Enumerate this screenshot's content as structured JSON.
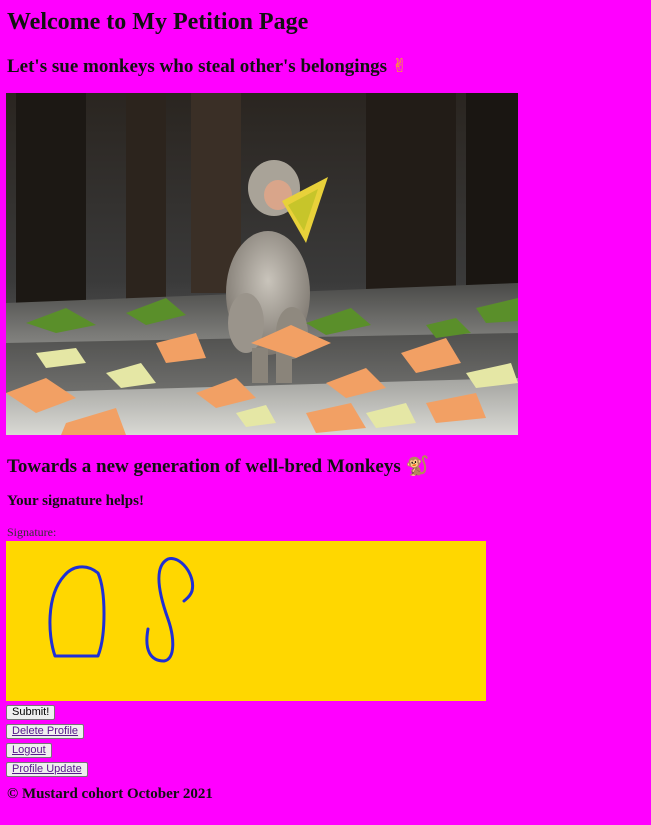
{
  "header": {
    "title": "Welcome to My Petition Page",
    "subtitle": "Let's sue monkeys who steal other's belongings",
    "subtitle_emoji": "✌"
  },
  "photo": {
    "subject": "monkey-eating-papaya-photo"
  },
  "body": {
    "heading": "Towards a new generation of well-bred Monkeys",
    "heading_emoji": "🐒",
    "signature_helps": "Your signature helps!",
    "signature_label": "Signature:"
  },
  "signature": {
    "background_color": "#ffd700",
    "stroke_color": "#1f2fd6"
  },
  "buttons": {
    "submit": "Submit!",
    "delete_profile": "Delete Profile",
    "logout": "Logout",
    "profile_update": "Profile Update"
  },
  "footer": {
    "text": "© Mustard cohort October 2021"
  },
  "colors": {
    "page_background": "#ff00ff"
  }
}
